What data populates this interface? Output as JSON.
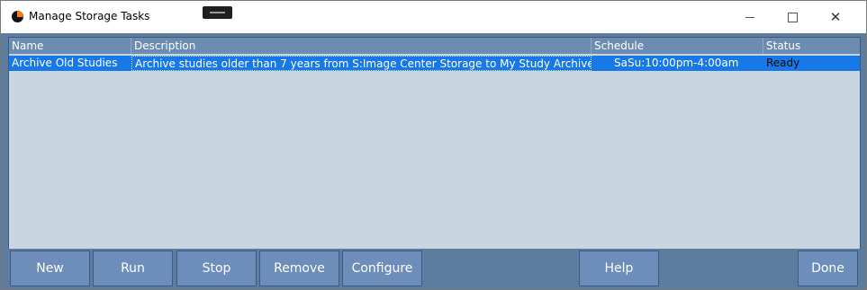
{
  "window": {
    "title": "Manage Storage Tasks",
    "icon": "app-logo-icon"
  },
  "table": {
    "columns": [
      "Name",
      "Description",
      "Schedule",
      "Status"
    ],
    "rows": [
      {
        "name": "Archive Old Studies",
        "description": "Archive studies older than 7 years from S:Image Center Storage to My Study Archive",
        "schedule": "SaSu:10:00pm-4:00am",
        "status": "Ready",
        "selected": true
      }
    ]
  },
  "buttons": {
    "new": "New",
    "run": "Run",
    "stop": "Stop",
    "remove": "Remove",
    "configure": "Configure",
    "help": "Help",
    "done": "Done"
  },
  "colors": {
    "selection": "#1778e8",
    "header": "#6c8cb2",
    "panel": "#5e7c9e",
    "grid_bg": "#c9d5e0"
  }
}
